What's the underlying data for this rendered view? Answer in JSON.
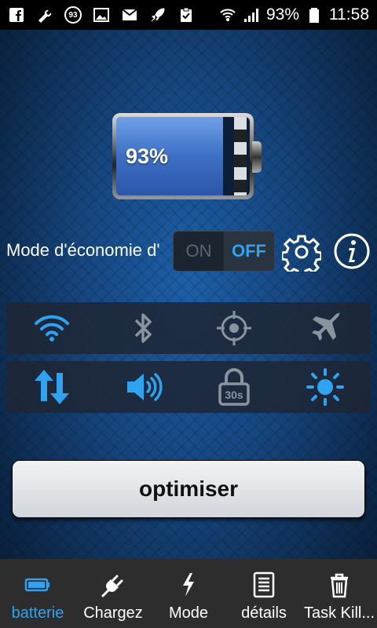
{
  "status_bar": {
    "notification_badge": "93",
    "battery_percent": "93%",
    "time": "11:58",
    "icons": [
      "facebook-icon",
      "wrench-icon",
      "badge-icon",
      "image-icon",
      "mail-icon",
      "rocket-icon",
      "clipboard-icon",
      "wifi-icon",
      "signal-icon",
      "battery-icon"
    ]
  },
  "battery": {
    "level_text": "93%",
    "level": 0.93,
    "fill_color": "#3d6fc4"
  },
  "mode": {
    "label": "Mode d'économie d'",
    "on_label": "ON",
    "off_label": "OFF",
    "state": "OFF"
  },
  "quick_toggles": {
    "row1": [
      "wifi-icon",
      "bluetooth-icon",
      "gps-icon",
      "airplane-icon"
    ],
    "row2": [
      "data-sync-icon",
      "volume-icon",
      "screen-timeout-icon",
      "brightness-icon"
    ],
    "timeout_text": "30s"
  },
  "optimize_button": "optimiser",
  "colors": {
    "accent": "#2fa2f0",
    "inactive": "#8a939e"
  },
  "bottom_nav": [
    {
      "label": "batterie",
      "icon": "battery-icon",
      "active": true
    },
    {
      "label": "Chargez",
      "icon": "plug-icon",
      "active": false
    },
    {
      "label": "Mode",
      "icon": "lightning-icon",
      "active": false
    },
    {
      "label": "détails",
      "icon": "list-icon",
      "active": false
    },
    {
      "label": "Task Kill...",
      "icon": "trash-icon",
      "active": false
    }
  ]
}
